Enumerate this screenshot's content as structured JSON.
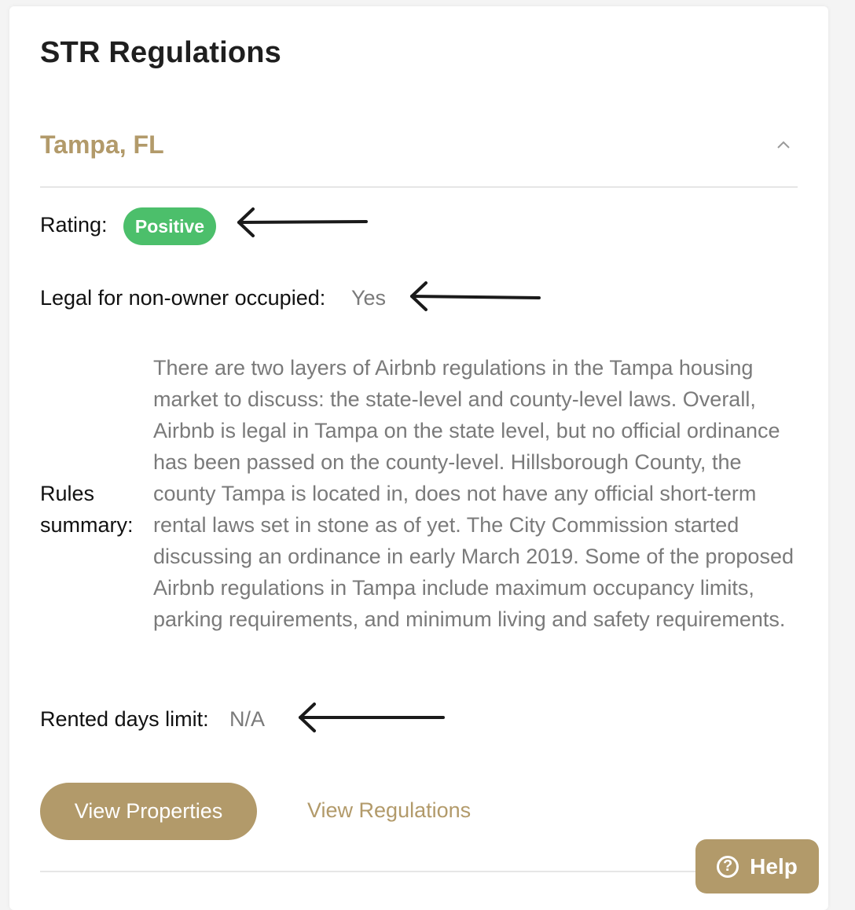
{
  "panel": {
    "title": "STR Regulations"
  },
  "location": {
    "city": "Tampa, FL",
    "collapse_icon": "chevron-up-icon"
  },
  "details": {
    "rating_label": "Rating:",
    "rating_value": "Positive",
    "legal_label": "Legal for non-owner occupied:",
    "legal_value": "Yes",
    "rules_label": "Rules summary:",
    "rules_text": "There are two layers of Airbnb regulations in the Tampa housing market to discuss: the state-level and county-level laws. Overall, Airbnb is legal in Tampa on the state level, but no official ordinance has been passed on the county-level. Hillsborough County, the county Tampa is located in, does not have any official short-term rental laws set in stone as of yet. The City Commission started discussing an ordinance in early March 2019. Some of the proposed Airbnb regulations in Tampa include maximum occupancy limits, parking requirements, and minimum living and safety requirements.",
    "days_label": "Rented days limit:",
    "days_value": "N/A"
  },
  "actions": {
    "view_properties": "View Properties",
    "view_regulations": "View Regulations"
  },
  "help_widget": {
    "label": "Help",
    "icon": "question-circle-icon",
    "glyph": "?"
  },
  "colors": {
    "accent": "#b29a6a",
    "positive_badge": "#4cbf6b",
    "annotation_arrow": "#1a1a1a"
  }
}
